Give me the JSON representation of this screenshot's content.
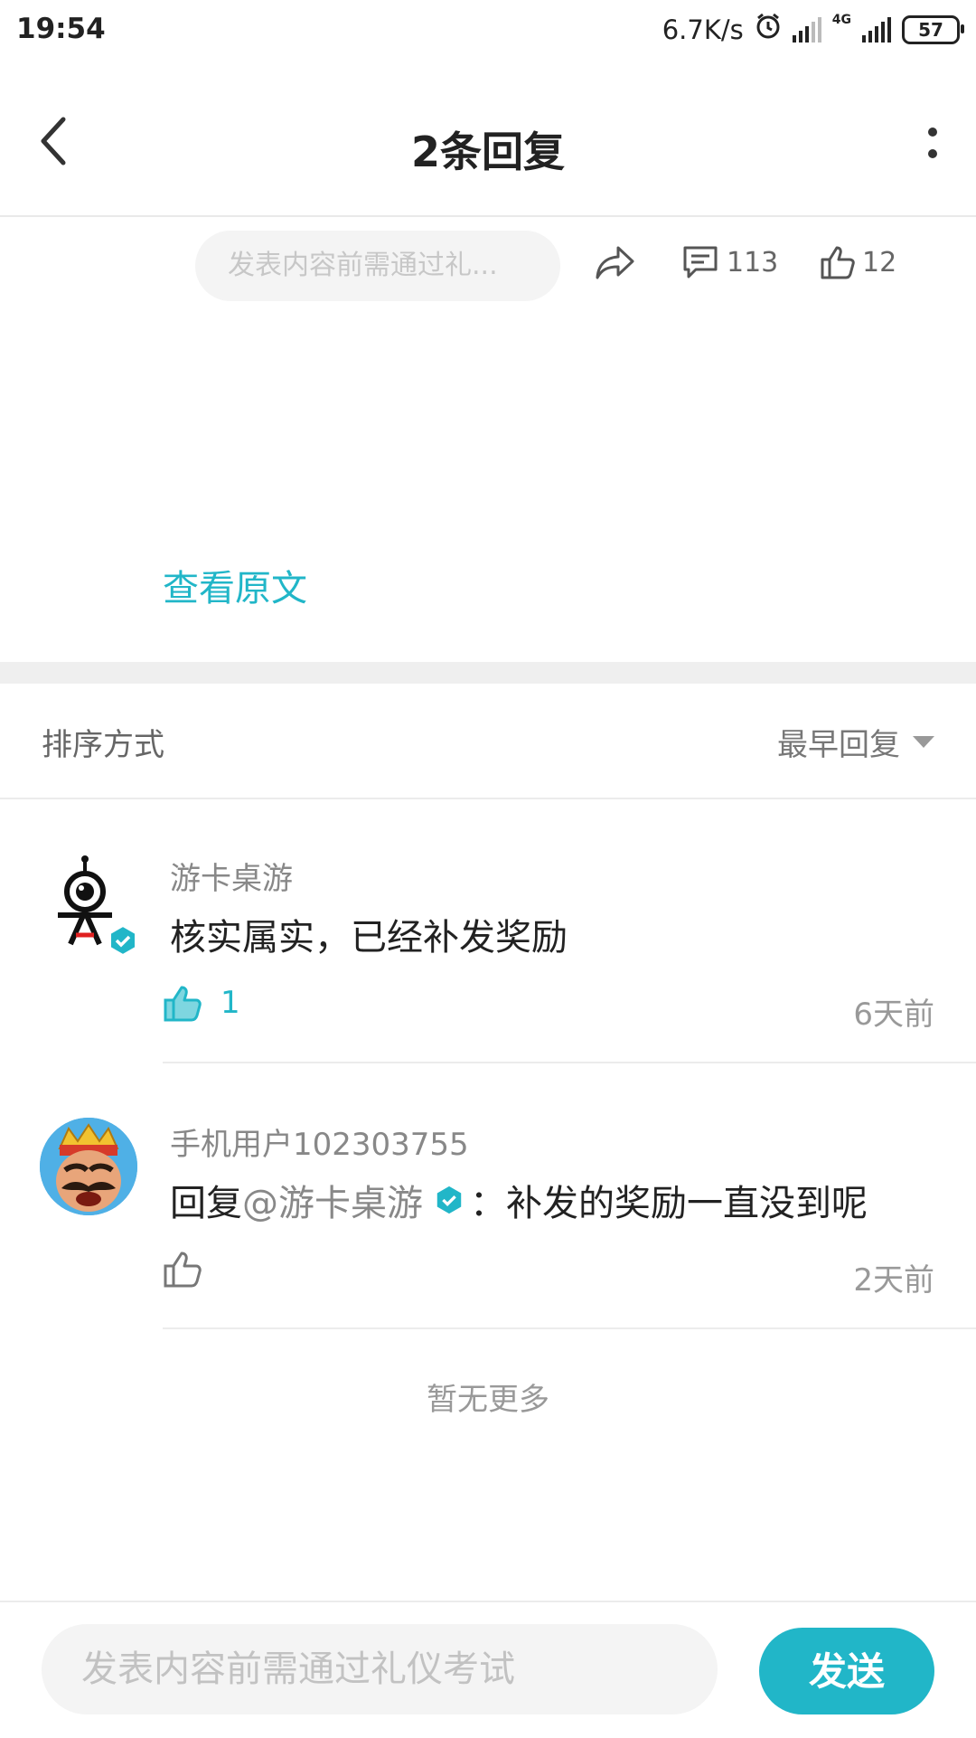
{
  "status": {
    "time": "19:54",
    "speed": "6.7K/s",
    "network": "4G",
    "battery": "57"
  },
  "header": {
    "title": "2条回复"
  },
  "action_row": {
    "input_placeholder": "发表内容前需通过礼...",
    "comment_count": "113",
    "like_count": "12"
  },
  "view_original": "查看原文",
  "sort": {
    "label": "排序方式",
    "value": "最早回复"
  },
  "comments": [
    {
      "name": "游卡桌游",
      "text": "核实属实，已经补发奖励",
      "likes": "1",
      "time": "6天前"
    },
    {
      "name": "手机用户102303755",
      "reply_prefix": "回复",
      "mention": "@游卡桌游",
      "reply_text": "：补发的奖励一直没到呢",
      "time": "2天前"
    }
  ],
  "no_more": "暂无更多",
  "bottom": {
    "placeholder": "发表内容前需通过礼仪考试",
    "send_label": "发送"
  },
  "colors": {
    "accent": "#21b6c8",
    "text": "#222222",
    "muted": "#999999"
  }
}
